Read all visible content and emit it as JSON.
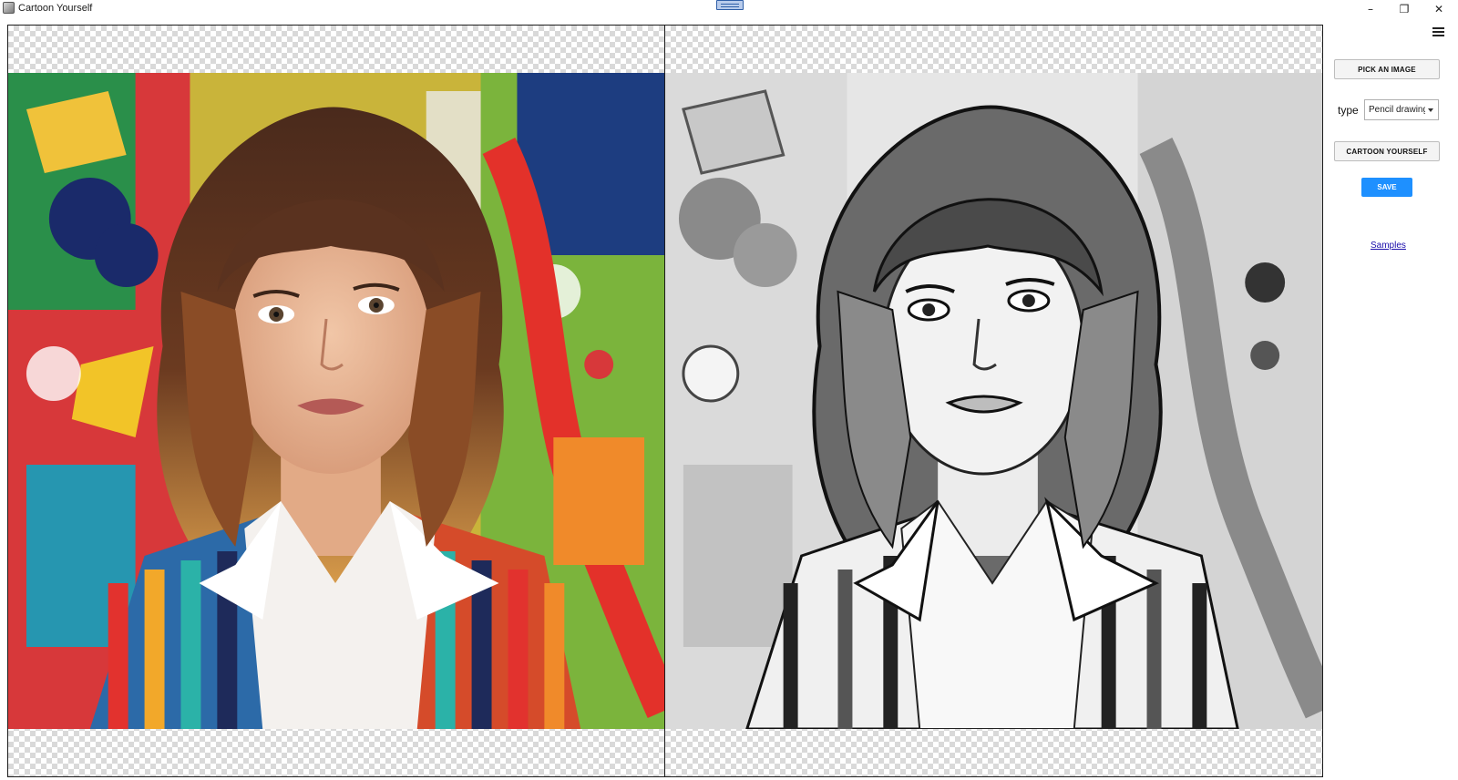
{
  "window": {
    "title": "Cartoon Yourself",
    "minimize_glyph": "–",
    "maximize_glyph": "❐",
    "close_glyph": "✕"
  },
  "panes": {
    "original_icon": "photo-portrait-image",
    "result_icon": "pencil-drawing-portrait-image"
  },
  "controls": {
    "pick_image_label": "PICK AN IMAGE",
    "type_label": "type",
    "type_selected": "Pencil drawing",
    "cartoon_label": "CARTOON YOURSELF",
    "save_label": "SAVE",
    "samples_link": "Samples"
  },
  "colors": {
    "save_button": "#1e90ff",
    "link": "#1a0dab"
  }
}
